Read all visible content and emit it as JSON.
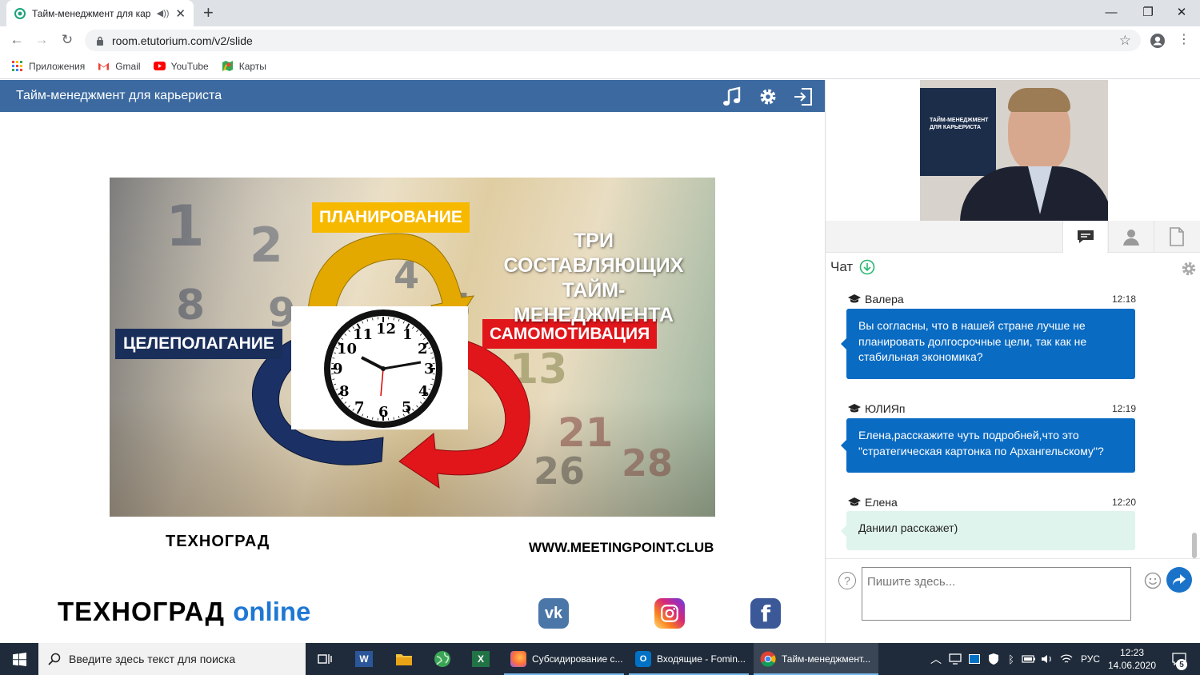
{
  "browser": {
    "tab_title": "Тайм-менеджмент для карьериста",
    "url": "room.etutorium.com/v2/slide",
    "bookmarks": [
      "Приложения",
      "Gmail",
      "YouTube",
      "Карты"
    ]
  },
  "app": {
    "header_title": "Тайм-менеджмент для карьериста"
  },
  "slide": {
    "label_planning": "ПЛАНИРОВАНИЕ",
    "label_goal": "ЦЕЛЕПОЛАГАНИЕ",
    "label_motivation": "САМОМОТИВАЦИЯ",
    "headline_1": "ТРИ СОСТАВЛЯЮЩИХ",
    "headline_2": "ТАЙМ-МЕНЕДЖМЕНТА",
    "logo_small": "ТЕХНОГРАД",
    "website": "WWW.MEETINGPOINT.CLUB",
    "logo_big": "ТЕХНОГРАД",
    "logo_big_suffix": "online",
    "clock_numbers": [
      "12",
      "1",
      "2",
      "3",
      "4",
      "5",
      "6",
      "7",
      "8",
      "9",
      "10",
      "11"
    ]
  },
  "video": {
    "screen_text_1": "ТАЙМ-МЕНЕДЖМЕНТ",
    "screen_text_2": "ДЛЯ КАРЬЕРИСТА"
  },
  "chat": {
    "title": "Чат",
    "messages": [
      {
        "author": "Валера",
        "time": "12:18",
        "text": "Вы согласны, что в нашей стране лучше не планировать долгосрочные цели, так как не стабильная экономика?"
      },
      {
        "author": "ЮЛИЯп",
        "time": "12:19",
        "text": "Елена,расскажите чуть подробней,что это \"стратегическая картонка по Архангельскому\"?"
      },
      {
        "author": "Елена",
        "time": "12:20",
        "text": "Даниил расскажет)"
      }
    ],
    "input_placeholder": "Пишите здесь..."
  },
  "taskbar": {
    "search_placeholder": "Введите здесь текст для поиска",
    "apps": [
      "Субсидирование с...",
      "Входящие - Fomin...",
      "Тайм-менеджмент..."
    ],
    "lang": "РУС",
    "time": "12:23",
    "date": "14.06.2020",
    "notifications": "5"
  },
  "colors": {
    "app_header": "#3c6aa0",
    "bubble_blue": "#0a6bc2",
    "bubble_mint": "#dff4ec",
    "planning": "#f7b900",
    "goal": "#1a2e5a",
    "motivation": "#e0161b"
  }
}
